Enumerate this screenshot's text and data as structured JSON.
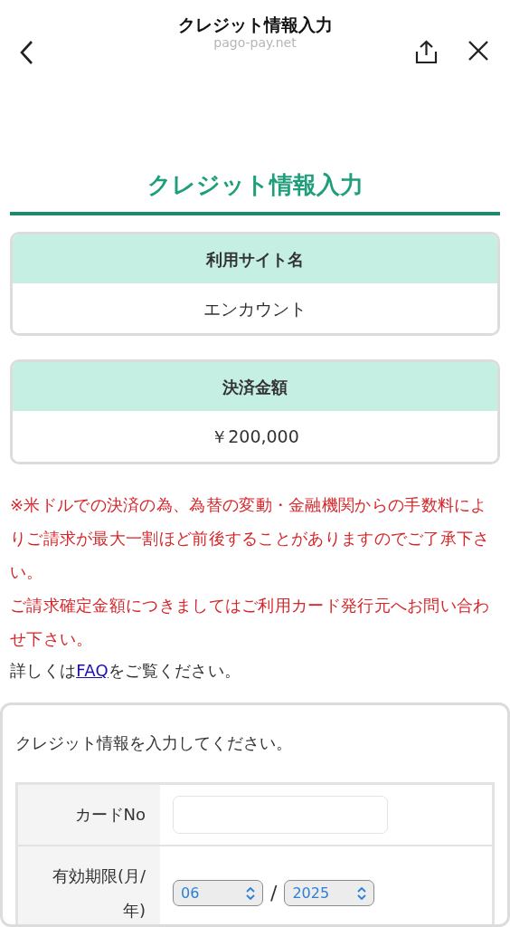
{
  "browser_bar": {
    "title": "クレジット情報入力",
    "domain": "pago-pay.net"
  },
  "page_title": "クレジット情報入力",
  "info_boxes": [
    {
      "label": "利用サイト名",
      "value": "エンカウント"
    },
    {
      "label": "決済金額",
      "value": "￥200,000"
    }
  ],
  "notices": [
    "※米ドルでの決済の為、為替の変動・金融機関からの手数料によりご請求が最大一割ほど前後することがありますのでご了承下さい。",
    "ご請求確定金額につきましてはご利用カード発行元へお問い合わせ下さい。"
  ],
  "faq_line": {
    "before": "詳しくは",
    "link": "FAQ",
    "after": "をご覧ください。"
  },
  "form": {
    "intro": "クレジット情報を入力してください。",
    "rows": [
      {
        "kind": "text",
        "label": "カードNo"
      },
      {
        "kind": "expiry",
        "label": "有効期限(月/年)",
        "month": "06",
        "separator": "/",
        "year": "2025"
      }
    ]
  }
}
